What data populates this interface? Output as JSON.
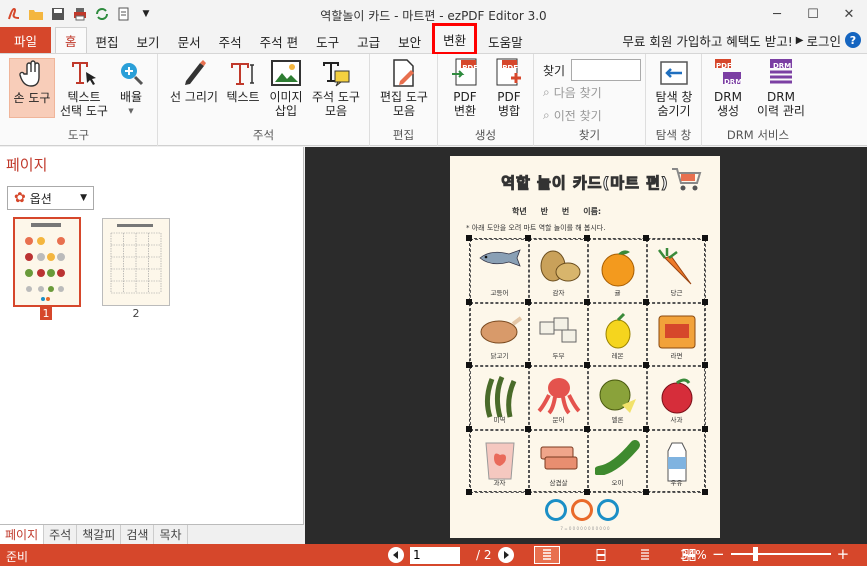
{
  "window": {
    "title": "역할놀이 카드 - 마트편 - ezPDF Editor 3.0",
    "minimize": "─",
    "maximize": "☐",
    "close": "✕"
  },
  "menu_tabs": [
    "파일",
    "홈",
    "편집",
    "보기",
    "문서",
    "주석",
    "주석 편",
    "도구",
    "고급",
    "보안",
    "변환",
    "도움말"
  ],
  "promo": "무료 회원 가입하고 혜택도 받고!",
  "login": "로그인",
  "help": "?",
  "ribbon": {
    "groups": {
      "tools": "도구",
      "annotation": "주석",
      "edit": "편집",
      "create": "생성",
      "find": "찾기",
      "navpane": "탐색 창",
      "drm": "DRM 서비스"
    },
    "buttons": {
      "hand": [
        "손 도구"
      ],
      "textsel": [
        "텍스트",
        "선택 도구"
      ],
      "arrange": [
        "배율"
      ],
      "draw": [
        "선 그리기"
      ],
      "text": [
        "텍스트"
      ],
      "image": [
        "이미지",
        "삽입"
      ],
      "annotools": [
        "주석 도구",
        "모음"
      ],
      "edittools": [
        "편집 도구",
        "모음"
      ],
      "pdfconv": [
        "PDF",
        "변환"
      ],
      "pdfmerge": [
        "PDF",
        "병합"
      ],
      "navhide": [
        "탐색 창",
        "숨기기"
      ],
      "drmcreate": [
        "DRM",
        "생성"
      ],
      "drmhist": [
        "DRM",
        "이력 관리"
      ]
    },
    "find_label": "찾기",
    "find_next": "다음 찾기",
    "find_prev": "이전 찾기",
    "pdf_badge": "PDF",
    "drm_badge": "DRM"
  },
  "left_panel": {
    "title": "페이지",
    "options": "옵션",
    "thumb_numbers": [
      "1",
      "2"
    ],
    "tabs": [
      "페이지",
      "주석",
      "책갈피",
      "검색",
      "목차"
    ]
  },
  "document": {
    "title": "역할 놀이 카드(마트 편)",
    "meta": "학년     반     번     이름:",
    "instruction": "* 아래 도안을 오려 마트 역할 놀이를 해 봅시다.",
    "items": [
      "고등어",
      "감자",
      "귤",
      "당근",
      "닭고기",
      "두부",
      "레몬",
      "라면",
      "미역",
      "문어",
      "멜론",
      "사과",
      "과자",
      "삼겹살",
      "오이",
      "우유"
    ],
    "item_art": [
      "fish",
      "potato",
      "orange",
      "carrot",
      "chicken",
      "tofu",
      "lemon",
      "ramen",
      "seaweed",
      "octopus",
      "melon",
      "apple",
      "snack",
      "porkbelly",
      "cucumber",
      "milk"
    ],
    "footer": "7 = 0 0 0 0 0 0 0 0 0 0 0"
  },
  "status": {
    "ready": "준비",
    "page_current": "1",
    "page_total": "/ 2",
    "zoom": "34%",
    "zoom_minus": "−",
    "zoom_plus": "+"
  },
  "colors": {
    "accent": "#d6472b",
    "highlight": "#ff0000"
  }
}
